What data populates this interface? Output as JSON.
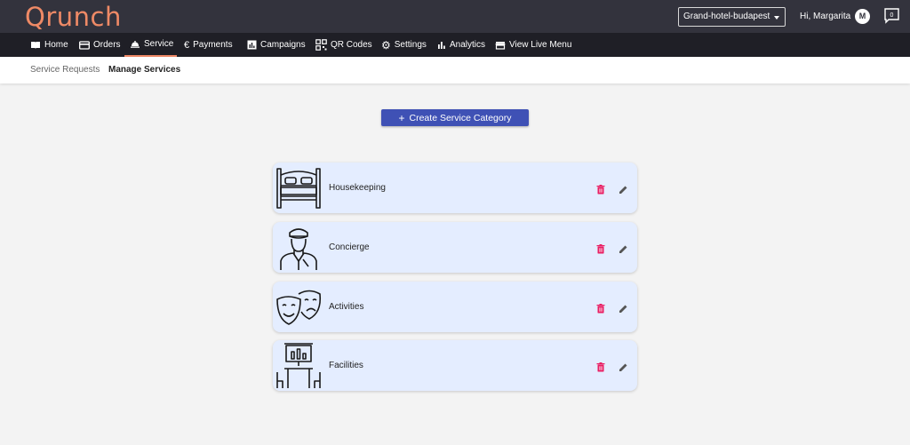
{
  "app": {
    "logo": "Qrunch"
  },
  "header": {
    "hotel_select": "Grand-hotel-budapest",
    "greeting": "Hi, Margarita",
    "avatar_initial": "M",
    "chat_count": "0"
  },
  "nav": {
    "items": [
      {
        "label": "Home",
        "icon": "book-icon"
      },
      {
        "label": "Orders",
        "icon": "card-icon"
      },
      {
        "label": "Service",
        "icon": "bell-icon",
        "active": true
      },
      {
        "label": "Payments",
        "icon": "euro-icon"
      },
      {
        "label": "Campaigns",
        "icon": "chart-icon"
      },
      {
        "label": "QR Codes",
        "icon": "qr-icon"
      },
      {
        "label": "Settings",
        "icon": "gear-icon"
      },
      {
        "label": "Analytics",
        "icon": "bar-chart-icon"
      },
      {
        "label": "View Live Menu",
        "icon": "store-icon"
      }
    ]
  },
  "subnav": {
    "items": [
      {
        "label": "Service Requests"
      },
      {
        "label": "Manage Services",
        "active": true
      }
    ]
  },
  "main": {
    "create_button": "Create Service Category",
    "categories": [
      {
        "label": "Housekeeping",
        "icon": "bed-icon"
      },
      {
        "label": "Concierge",
        "icon": "concierge-icon"
      },
      {
        "label": "Activities",
        "icon": "theater-masks-icon"
      },
      {
        "label": "Facilities",
        "icon": "meeting-room-icon"
      }
    ]
  },
  "colors": {
    "topbar": "#33333d",
    "navbar": "#1f1f26",
    "accent": "#ef8a66",
    "primary_button": "#3f51b5",
    "card_bg": "#e4edff",
    "delete": "#e91e63"
  }
}
